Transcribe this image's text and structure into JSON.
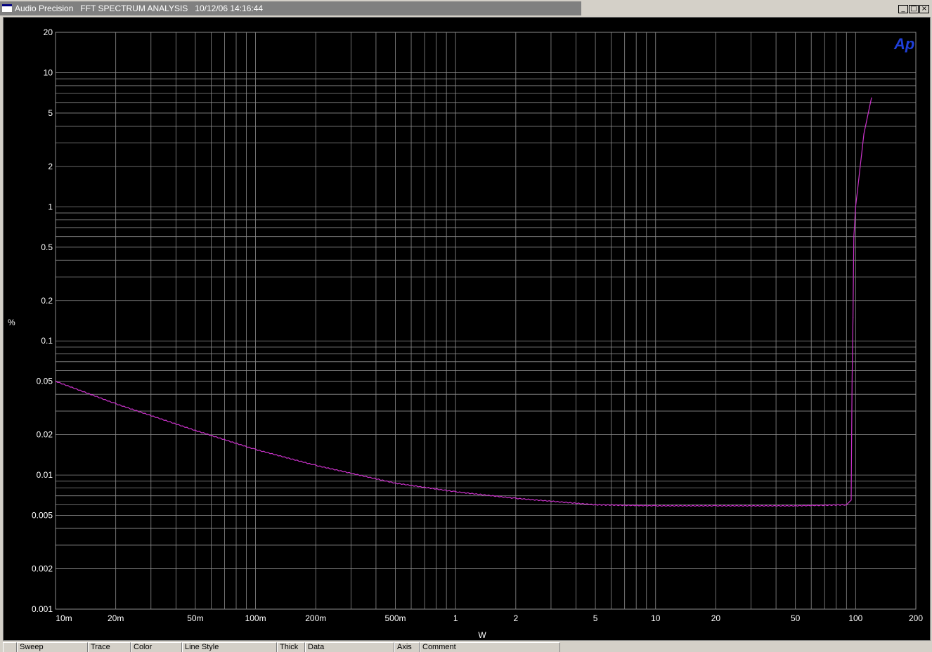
{
  "window": {
    "title": "Audio Precision   FFT SPECTRUM ANALYSIS   10/12/06 14:16:44",
    "buttons": [
      "_",
      "□",
      "×"
    ]
  },
  "logo_text": "Ap",
  "colors": {
    "background": "#000000",
    "grid": "#8c8c8c",
    "trace": "#cc33cc",
    "logo": "#1f3fd8",
    "text": "#ffffff"
  },
  "statusbar": {
    "columns": [
      "",
      "Sweep",
      "Trace",
      "Color",
      "Line Style",
      "Thick",
      "Data",
      "Axis",
      "Comment"
    ]
  },
  "chart_data": {
    "type": "line",
    "xlabel": "W",
    "ylabel": "%",
    "x_scale": "log",
    "y_scale": "log",
    "xlim": [
      0.01,
      200
    ],
    "ylim": [
      0.001,
      20
    ],
    "grid": true,
    "x_ticks": [
      {
        "value": 0.01,
        "label": "10m"
      },
      {
        "value": 0.02,
        "label": "20m"
      },
      {
        "value": 0.05,
        "label": "50m"
      },
      {
        "value": 0.1,
        "label": "100m"
      },
      {
        "value": 0.2,
        "label": "200m"
      },
      {
        "value": 0.5,
        "label": "500m"
      },
      {
        "value": 1,
        "label": "1"
      },
      {
        "value": 2,
        "label": "2"
      },
      {
        "value": 5,
        "label": "5"
      },
      {
        "value": 10,
        "label": "10"
      },
      {
        "value": 20,
        "label": "20"
      },
      {
        "value": 50,
        "label": "50"
      },
      {
        "value": 100,
        "label": "100"
      },
      {
        "value": 200,
        "label": "200"
      }
    ],
    "y_ticks": [
      {
        "value": 20,
        "label": "20"
      },
      {
        "value": 10,
        "label": "10"
      },
      {
        "value": 5,
        "label": "5"
      },
      {
        "value": 2,
        "label": "2"
      },
      {
        "value": 1,
        "label": "1"
      },
      {
        "value": 0.5,
        "label": "0.5"
      },
      {
        "value": 0.2,
        "label": "0.2"
      },
      {
        "value": 0.1,
        "label": "0.1"
      },
      {
        "value": 0.05,
        "label": "0.05"
      },
      {
        "value": 0.02,
        "label": "0.02"
      },
      {
        "value": 0.01,
        "label": "0.01"
      },
      {
        "value": 0.005,
        "label": "0.005"
      },
      {
        "value": 0.002,
        "label": "0.002"
      },
      {
        "value": 0.001,
        "label": "0.001"
      }
    ],
    "series": [
      {
        "x": [
          0.01,
          0.02,
          0.05,
          0.1,
          0.2,
          0.5,
          1,
          2,
          5,
          10,
          20,
          50,
          90,
          95,
          96,
          97,
          98,
          100,
          110,
          120
        ],
        "y": [
          0.05,
          0.034,
          0.0215,
          0.0155,
          0.0118,
          0.0087,
          0.0075,
          0.0067,
          0.006,
          0.0059,
          0.0059,
          0.0059,
          0.006,
          0.0065,
          0.05,
          0.15,
          0.6,
          1.0,
          3.5,
          6.5
        ]
      }
    ]
  }
}
